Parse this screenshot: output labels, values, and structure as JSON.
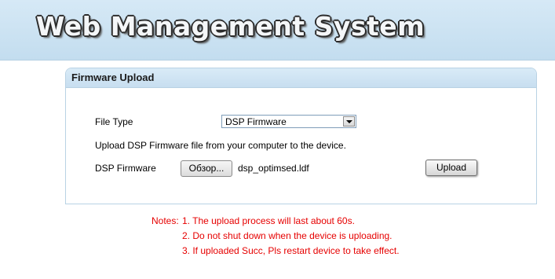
{
  "header": {
    "title": "Web Management System"
  },
  "panel": {
    "title": "Firmware Upload",
    "file_type_label": "File Type",
    "file_type_value": "DSP Firmware",
    "description": "Upload DSP Firmware file from your computer to the device.",
    "firmware_label": "DSP Firmware",
    "browse_label": "Обзор...",
    "file_name": "dsp_optimsed.ldf",
    "upload_label": "Upload"
  },
  "notes": {
    "heading": "Notes:",
    "lines": [
      "1. The upload process will last about 60s.",
      "2. Do not shut down when the device is uploading.",
      "3. If uploaded Succ, Pls restart device to take effect."
    ]
  },
  "colors": {
    "banner": "#c3ddef",
    "notes_text": "#e60000",
    "panel_border": "#b9d2e4"
  }
}
